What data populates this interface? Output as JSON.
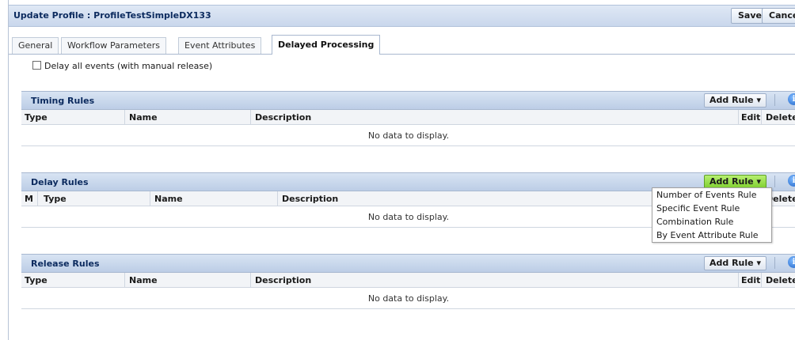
{
  "header": {
    "title": "Update Profile : ProfileTestSimpleDX133",
    "save_label": "Save",
    "cancel_label": "Cance"
  },
  "tabs": [
    {
      "label": "General"
    },
    {
      "label": "Workflow Parameters"
    },
    {
      "label": "Event Attributes"
    },
    {
      "label": "Delayed Processing",
      "active": true
    }
  ],
  "delay_all": {
    "label": "Delay all events (with manual release)",
    "checked": false
  },
  "timing_rules": {
    "title": "Timing Rules",
    "add_label": "Add Rule",
    "columns": {
      "type": "Type",
      "name": "Name",
      "description": "Description",
      "edit": "Edit",
      "delete": "Delete"
    },
    "empty": "No data to display."
  },
  "delay_rules": {
    "title": "Delay Rules",
    "add_label": "Add Rule",
    "columns": {
      "m": "M",
      "type": "Type",
      "name": "Name",
      "description": "Description",
      "delete": "Delete"
    },
    "empty": "No data to display.",
    "menu": [
      "Number of Events Rule",
      "Specific Event Rule",
      "Combination Rule",
      "By Event Attribute Rule"
    ]
  },
  "release_rules": {
    "title": "Release Rules",
    "add_label": "Add Rule",
    "columns": {
      "type": "Type",
      "name": "Name",
      "description": "Description",
      "edit": "Edit",
      "delete": "Delete"
    },
    "empty": "No data to display."
  },
  "icons": {
    "info": "info-icon",
    "dropdown": "caret-down-icon"
  },
  "colors": {
    "header": "#c9d7ec",
    "active_add": "#7fcf2f",
    "title_text": "#0b2a5e"
  }
}
